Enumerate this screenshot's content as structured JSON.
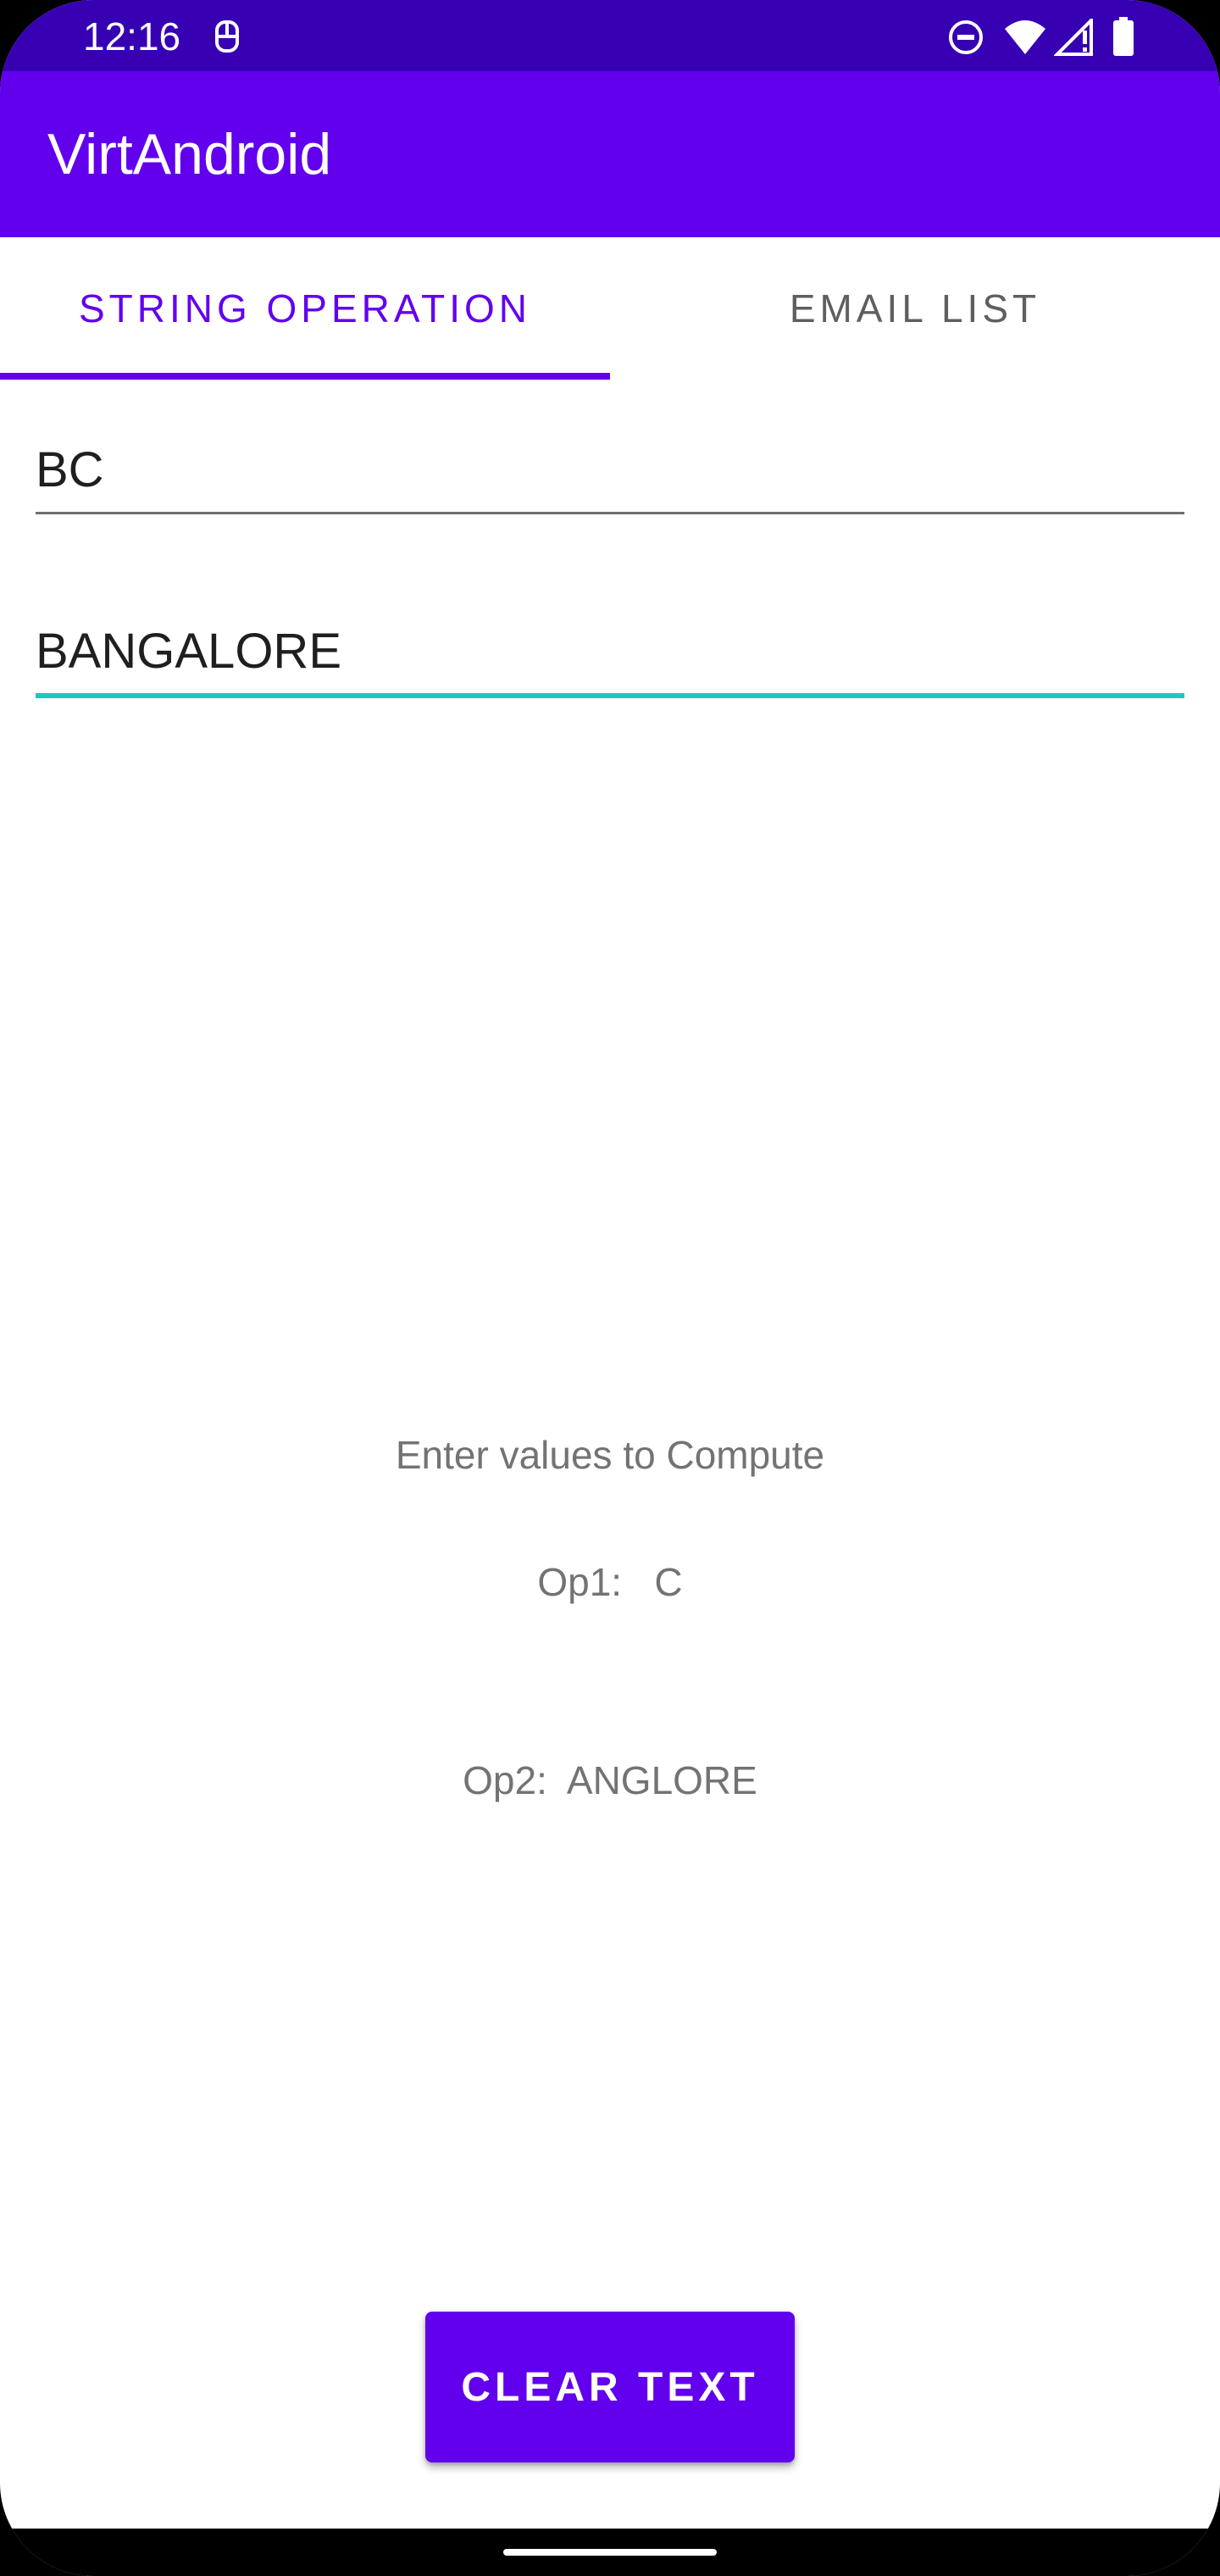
{
  "status_bar": {
    "time": "12:16",
    "icons": [
      "notification-icon",
      "do-not-disturb-icon",
      "wifi-icon",
      "cellular-signal-icon",
      "battery-icon"
    ]
  },
  "app_bar": {
    "title": "VirtAndroid"
  },
  "tabs": [
    {
      "label": "STRING OPERATION",
      "selected": true
    },
    {
      "label": "EMAIL LIST",
      "selected": false
    }
  ],
  "fields": {
    "first_value": "BC",
    "second_value": "BANGALORE"
  },
  "results": {
    "heading": "Enter values to Compute",
    "op1": "Op1:   C",
    "op2": "Op2:  ANGLORE"
  },
  "clear_button": {
    "label": "CLEAR TEXT"
  },
  "colors": {
    "status_bar": "#3700B3",
    "primary": "#6200EE",
    "focus_underline": "#1FC7BE",
    "inactive_tab": "#5f5f5f"
  }
}
